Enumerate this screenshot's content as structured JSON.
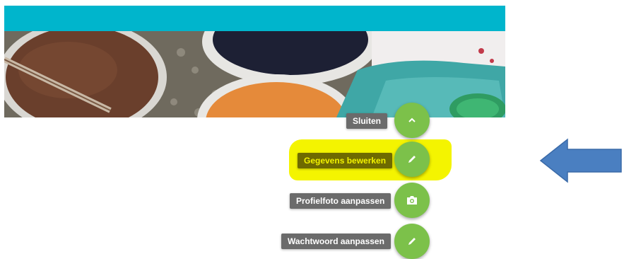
{
  "header": {
    "bar_color": "#00b5cc"
  },
  "banner": {
    "image": "paint-cans-photo"
  },
  "speed_dial": {
    "accent": "#7cc14a",
    "actions": [
      {
        "label": "Sluiten",
        "icon": "chevron-up-icon"
      },
      {
        "label": "Gegevens bewerken",
        "icon": "pencil-icon",
        "highlighted": true
      },
      {
        "label": "Profielfoto aanpassen",
        "icon": "camera-icon"
      },
      {
        "label": "Wachtwoord aanpassen",
        "icon": "pencil-icon"
      }
    ]
  },
  "annotation": {
    "highlight_color": "#f4f400",
    "arrow_color": "#4a7fc1",
    "arrow_icon": "left-arrow-icon"
  }
}
